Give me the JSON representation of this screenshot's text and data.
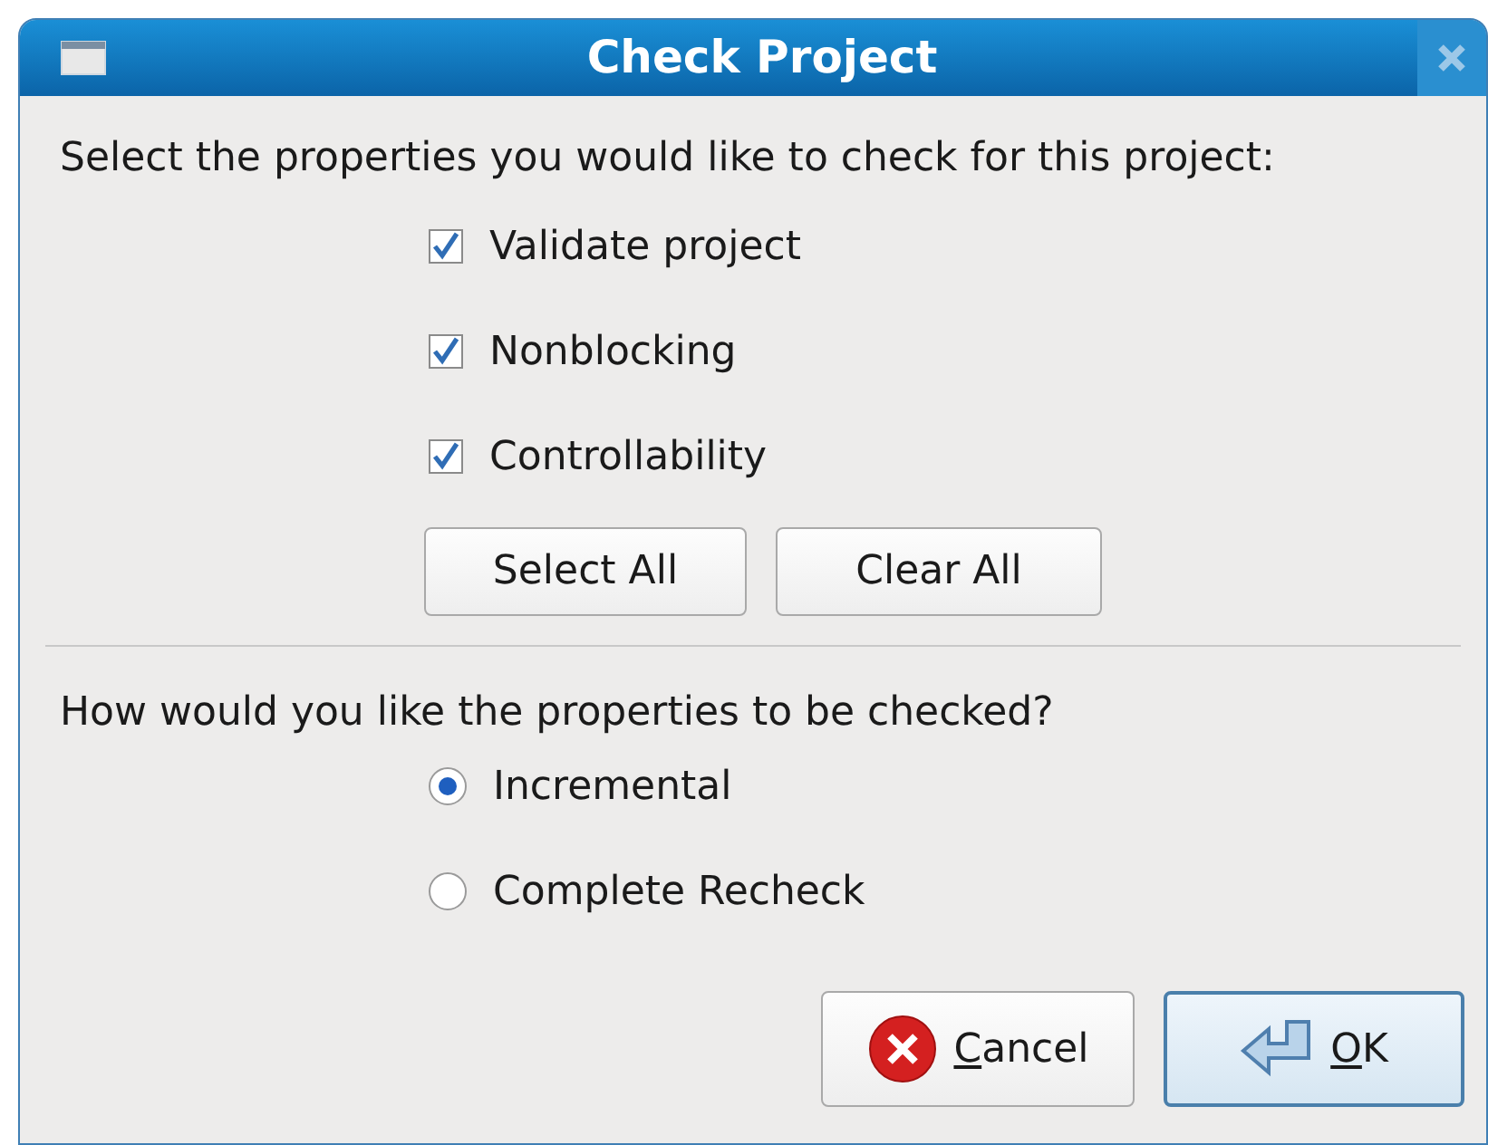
{
  "window": {
    "title": "Check Project"
  },
  "properties_prompt": "Select the properties you would like to check for this project:",
  "properties": [
    {
      "label": "Validate project",
      "checked": true
    },
    {
      "label": "Nonblocking",
      "checked": true
    },
    {
      "label": "Controllability",
      "checked": true
    }
  ],
  "selection_buttons": [
    "Select All",
    "Clear All"
  ],
  "mode_prompt": "How would you like the properties to be checked?",
  "modes": [
    {
      "label": "Incremental",
      "selected": true
    },
    {
      "label": "Complete Recheck",
      "selected": false
    }
  ],
  "dialog_buttons": [
    {
      "kind": "cancel",
      "access_key": "C",
      "label_rest": "ancel",
      "default": false
    },
    {
      "kind": "ok",
      "access_key": "O",
      "label_rest": "K",
      "default": true
    }
  ]
}
